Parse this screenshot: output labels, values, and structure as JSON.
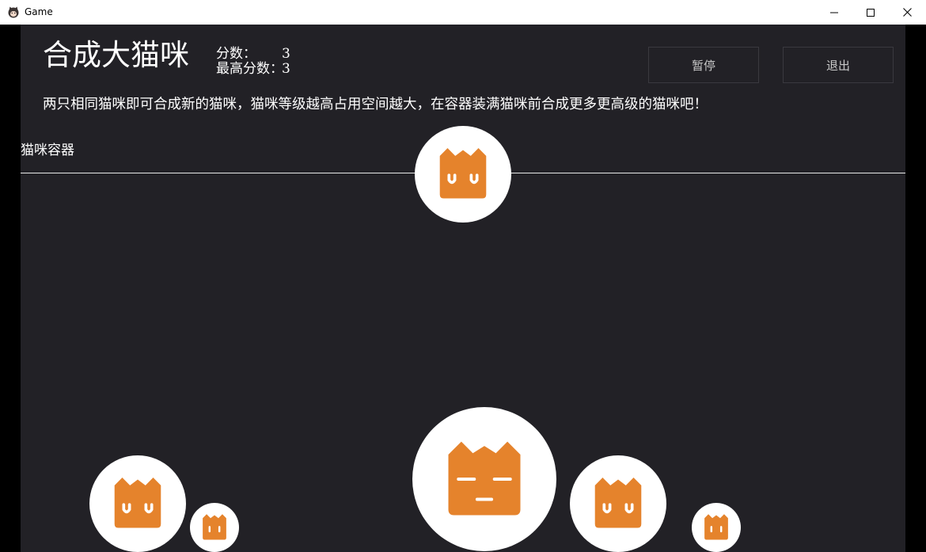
{
  "window": {
    "title": "Game",
    "icons": {
      "app": "cat-app-icon",
      "minimize": "minimize-icon",
      "maximize": "maximize-icon",
      "close": "close-icon"
    }
  },
  "game": {
    "title": "合成大猫咪",
    "score_label": "分数：",
    "score_value": "3",
    "best_label": "最高分数：",
    "best_value": "3",
    "pause_label": "暂停",
    "exit_label": "退出",
    "instructions": "两只相同猫咪即可合成新的猫咪，猫咪等级越高占用空间越大，在容器装满猫咪前合成更多更高级的猫咪吧！",
    "container_label": "猫咪容器"
  },
  "colors": {
    "background": "#222126",
    "cat_orange": "#e5832c",
    "ball_white": "#ffffff"
  },
  "cats": [
    {
      "id": "falling",
      "level": 2,
      "face": "happy"
    },
    {
      "id": "bottom-1",
      "level": 2,
      "face": "happy"
    },
    {
      "id": "bottom-2",
      "level": 1,
      "face": "plain"
    },
    {
      "id": "bottom-3",
      "level": 3,
      "face": "sleepy"
    },
    {
      "id": "bottom-4",
      "level": 2,
      "face": "happy"
    },
    {
      "id": "bottom-5",
      "level": 1,
      "face": "plain"
    }
  ]
}
